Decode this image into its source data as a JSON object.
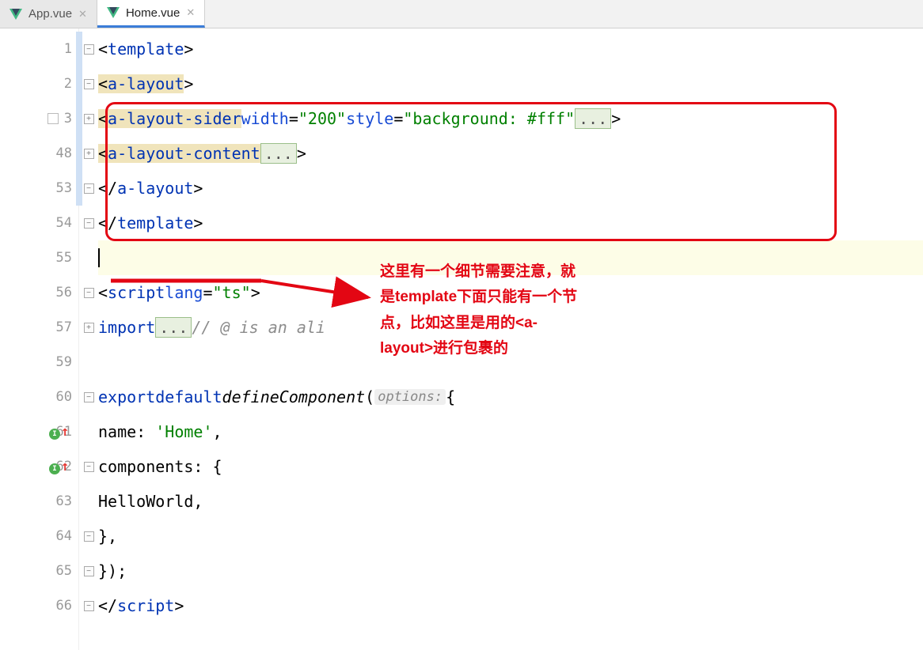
{
  "tabs": [
    {
      "label": "App.vue",
      "active": false
    },
    {
      "label": "Home.vue",
      "active": true
    }
  ],
  "lines": {
    "n1": "1",
    "n2": "2",
    "n3": "3",
    "n48": "48",
    "n53": "53",
    "n54": "54",
    "n55": "55",
    "n56": "56",
    "n57": "57",
    "n59": "59",
    "n60": "60",
    "n61": "61",
    "n62": "62",
    "n63": "63",
    "n64": "64",
    "n65": "65",
    "n66": "66"
  },
  "code": {
    "template_open_lt": "<",
    "template": "template",
    "gt": ">",
    "a_layout": "a-layout",
    "a_layout_sider": "a-layout-sider",
    "width_attr": "width",
    "width_val": "\"200\"",
    "style_attr": "style",
    "style_val": "\"background: #fff\"",
    "a_layout_content": "a-layout-content",
    "ellipsis": "...",
    "close_a_layout": "a-layout",
    "close_template": "template",
    "script_open": "script",
    "lang_attr": "lang",
    "lang_val": "\"ts\"",
    "import_kw": "import",
    "import_fold": "...",
    "import_comment": "// @ is an ali",
    "export_kw": "export",
    "default_kw": "default",
    "defineComponent": "defineComponent",
    "options_hint": "options:",
    "name_key": "name",
    "name_val": "'Home'",
    "components_key": "components",
    "helloworld": "HelloWorld",
    "close_script": "script"
  },
  "annotation": "这里有一个细节需要注意，就是template下面只能有一个节点，比如这里是用的<a-layout>进行包裹的"
}
